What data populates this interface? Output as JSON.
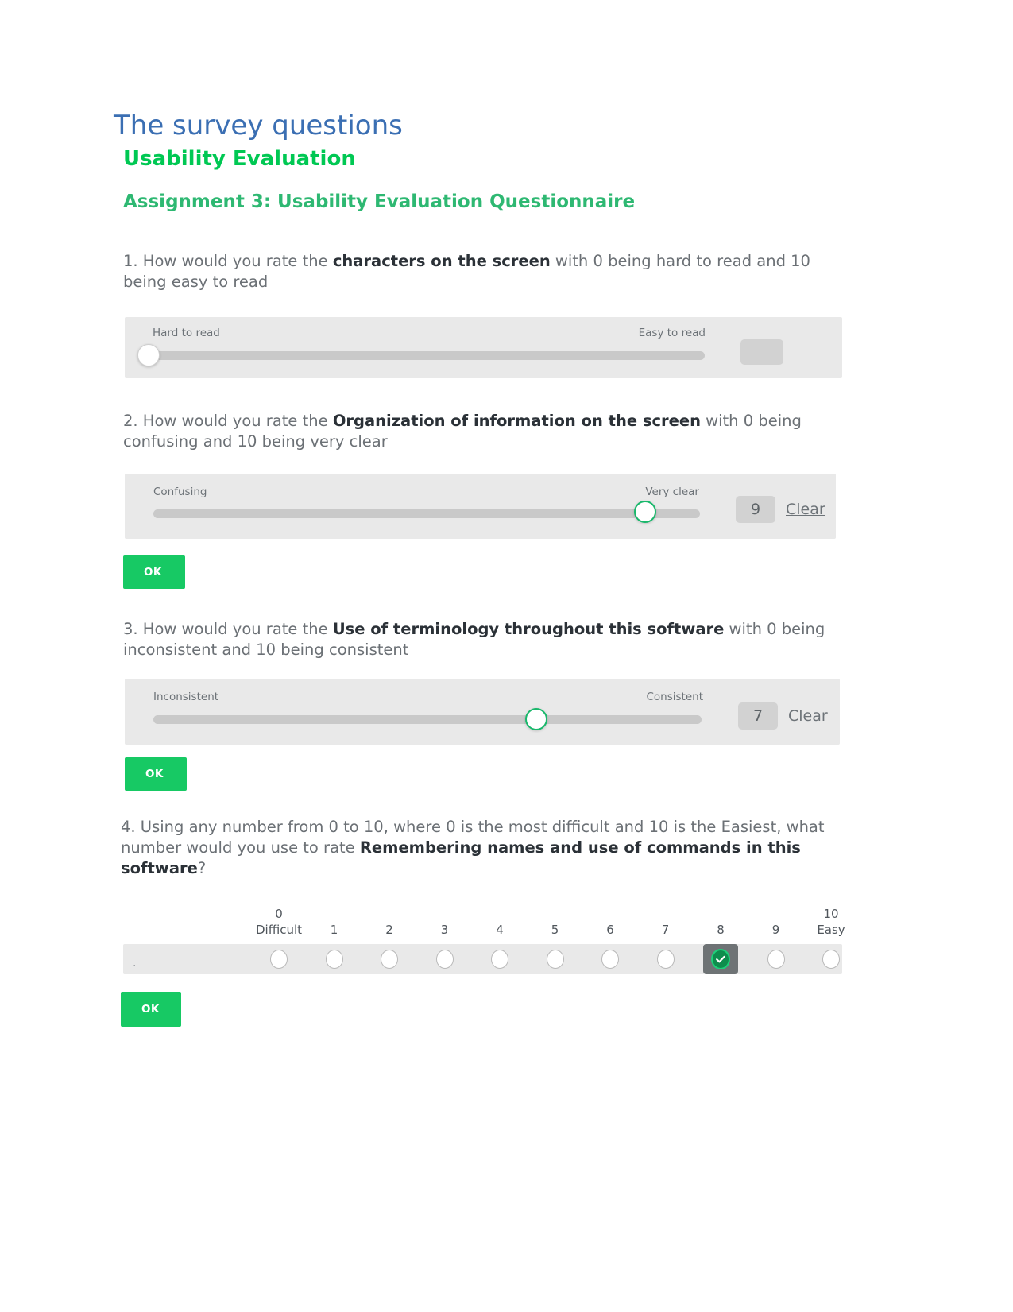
{
  "header": {
    "title": "The survey questions",
    "subtitle": "Usability Evaluation",
    "assignment": "Assignment 3: Usability Evaluation Questionnaire"
  },
  "colors": {
    "title_blue": "#3b6fb3",
    "brand_green": "#00c853",
    "assignment_green": "#2eb872",
    "ok_button_green": "#17c964",
    "panel_gray": "#e9e9e9",
    "track_gray": "#c9c9c9",
    "selected_cell_gray": "#6e7375",
    "checked_radio_green": "#0e8d4d"
  },
  "questions": [
    {
      "number": "1.",
      "text_before": "1. How would you rate the ",
      "bold": "characters on the screen",
      "text_after": " with 0 being hard to read and 10 being easy to read",
      "control": "slider",
      "left_label": "Hard to read",
      "right_label": "Easy to read",
      "value": "",
      "percent": 0,
      "clear_label": "",
      "ok_label": ""
    },
    {
      "number": "2.",
      "text_before": "2. How would you rate the ",
      "bold": "Organization of information on the screen",
      "text_after": " with 0 being confusing and 10 being very clear",
      "control": "slider",
      "left_label": "Confusing",
      "right_label": "Very clear",
      "value": "9",
      "percent": 90,
      "clear_label": "Clear",
      "ok_label": "OK"
    },
    {
      "number": "3.",
      "text_before": "3. How would you rate the ",
      "bold": "Use of terminology throughout this software",
      "text_after": " with 0 being inconsistent and 10 being consistent",
      "control": "slider",
      "left_label": "Inconsistent",
      "right_label": "Consistent",
      "value": "7",
      "percent": 70,
      "clear_label": "Clear",
      "ok_label": "OK"
    },
    {
      "number": "4.",
      "text_before": "4. Using any number from 0 to 10, where 0 is the most difficult and 10 is the Easiest, what number would you use to rate ",
      "bold": "Remembering names and use of commands in this software",
      "text_after": "?",
      "control": "radio-scale",
      "ok_label": "OK"
    }
  ],
  "scale": {
    "leading_marker": ".",
    "selected_value": "8",
    "items": [
      {
        "value": "0",
        "top_label": "0",
        "bottom_label": "Difficult",
        "selected": false
      },
      {
        "value": "1",
        "top_label": "",
        "bottom_label": "1",
        "selected": false
      },
      {
        "value": "2",
        "top_label": "",
        "bottom_label": "2",
        "selected": false
      },
      {
        "value": "3",
        "top_label": "",
        "bottom_label": "3",
        "selected": false
      },
      {
        "value": "4",
        "top_label": "",
        "bottom_label": "4",
        "selected": false
      },
      {
        "value": "5",
        "top_label": "",
        "bottom_label": "5",
        "selected": false
      },
      {
        "value": "6",
        "top_label": "",
        "bottom_label": "6",
        "selected": false
      },
      {
        "value": "7",
        "top_label": "",
        "bottom_label": "7",
        "selected": false
      },
      {
        "value": "8",
        "top_label": "",
        "bottom_label": "8",
        "selected": true
      },
      {
        "value": "9",
        "top_label": "",
        "bottom_label": "9",
        "selected": false
      },
      {
        "value": "10",
        "top_label": "10",
        "bottom_label": "Easy",
        "selected": false
      }
    ]
  },
  "icons": {
    "check": "check-icon"
  }
}
